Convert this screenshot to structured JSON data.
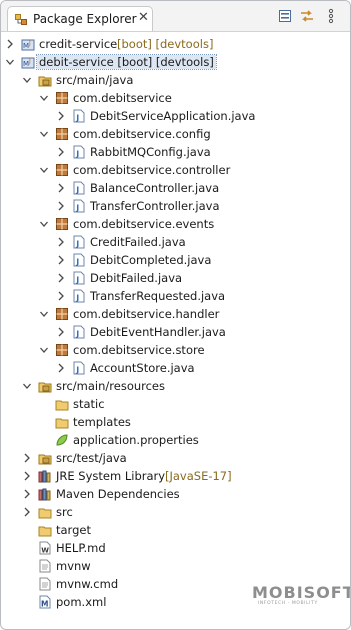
{
  "tab": {
    "title": "Package Explorer",
    "close": "✕"
  },
  "toolbar": {
    "collapse_icon": "collapse-all-icon",
    "link_icon": "link-with-editor-icon",
    "menu_icon": "view-menu-icon"
  },
  "tree": [
    {
      "label": "credit-service",
      "decor": " [boot] [devtools]",
      "icon": "project",
      "depth": 0,
      "twisty": "closed",
      "selected": false
    },
    {
      "label": "debit-service [boot] [devtools]",
      "decor": "",
      "icon": "project",
      "depth": 0,
      "twisty": "open",
      "selected": true
    },
    {
      "label": "src/main/java",
      "decor": "",
      "icon": "srcfolder",
      "depth": 1,
      "twisty": "open"
    },
    {
      "label": "com.debitservice",
      "decor": "",
      "icon": "package",
      "depth": 2,
      "twisty": "open"
    },
    {
      "label": "DebitServiceApplication.java",
      "decor": "",
      "icon": "java",
      "depth": 3,
      "twisty": "closed"
    },
    {
      "label": "com.debitservice.config",
      "decor": "",
      "icon": "package",
      "depth": 2,
      "twisty": "open"
    },
    {
      "label": "RabbitMQConfig.java",
      "decor": "",
      "icon": "java",
      "depth": 3,
      "twisty": "closed"
    },
    {
      "label": "com.debitservice.controller",
      "decor": "",
      "icon": "package",
      "depth": 2,
      "twisty": "open"
    },
    {
      "label": "BalanceController.java",
      "decor": "",
      "icon": "java",
      "depth": 3,
      "twisty": "closed"
    },
    {
      "label": "TransferController.java",
      "decor": "",
      "icon": "java",
      "depth": 3,
      "twisty": "closed"
    },
    {
      "label": "com.debitservice.events",
      "decor": "",
      "icon": "package",
      "depth": 2,
      "twisty": "open"
    },
    {
      "label": "CreditFailed.java",
      "decor": "",
      "icon": "java",
      "depth": 3,
      "twisty": "closed"
    },
    {
      "label": "DebitCompleted.java",
      "decor": "",
      "icon": "java",
      "depth": 3,
      "twisty": "closed"
    },
    {
      "label": "DebitFailed.java",
      "decor": "",
      "icon": "java",
      "depth": 3,
      "twisty": "closed"
    },
    {
      "label": "TransferRequested.java",
      "decor": "",
      "icon": "java",
      "depth": 3,
      "twisty": "closed"
    },
    {
      "label": "com.debitservice.handler",
      "decor": "",
      "icon": "package",
      "depth": 2,
      "twisty": "open"
    },
    {
      "label": "DebitEventHandler.java",
      "decor": "",
      "icon": "java",
      "depth": 3,
      "twisty": "closed"
    },
    {
      "label": "com.debitservice.store",
      "decor": "",
      "icon": "package",
      "depth": 2,
      "twisty": "open"
    },
    {
      "label": "AccountStore.java",
      "decor": "",
      "icon": "java",
      "depth": 3,
      "twisty": "closed"
    },
    {
      "label": "src/main/resources",
      "decor": "",
      "icon": "srcfolder",
      "depth": 1,
      "twisty": "open"
    },
    {
      "label": "static",
      "decor": "",
      "icon": "folder",
      "depth": 2,
      "twisty": "none"
    },
    {
      "label": "templates",
      "decor": "",
      "icon": "folder",
      "depth": 2,
      "twisty": "none"
    },
    {
      "label": "application.properties",
      "decor": "",
      "icon": "properties",
      "depth": 2,
      "twisty": "none"
    },
    {
      "label": "src/test/java",
      "decor": "",
      "icon": "srcfolder",
      "depth": 1,
      "twisty": "closed"
    },
    {
      "label": "JRE System Library",
      "decor": " [JavaSE-17]",
      "icon": "library",
      "depth": 1,
      "twisty": "closed"
    },
    {
      "label": "Maven Dependencies",
      "decor": "",
      "icon": "library",
      "depth": 1,
      "twisty": "closed"
    },
    {
      "label": "src",
      "decor": "",
      "icon": "folder",
      "depth": 1,
      "twisty": "closed"
    },
    {
      "label": "target",
      "decor": "",
      "icon": "folder",
      "depth": 1,
      "twisty": "none"
    },
    {
      "label": "HELP.md",
      "decor": "",
      "icon": "file-md",
      "depth": 1,
      "twisty": "none"
    },
    {
      "label": "mvnw",
      "decor": "",
      "icon": "file",
      "depth": 1,
      "twisty": "none"
    },
    {
      "label": "mvnw.cmd",
      "decor": "",
      "icon": "file",
      "depth": 1,
      "twisty": "none"
    },
    {
      "label": "pom.xml",
      "decor": "",
      "icon": "file-xml",
      "depth": 1,
      "twisty": "none"
    }
  ],
  "watermark": {
    "brand": "MOBISOFT",
    "sub": "INFOTECH · MOBILITY"
  },
  "colors": {
    "package": "#a9652e",
    "java": "#3a6fb7",
    "folder": "#e8b94a",
    "selection": "#dde6f3",
    "decoration": "#8a6a1e"
  }
}
